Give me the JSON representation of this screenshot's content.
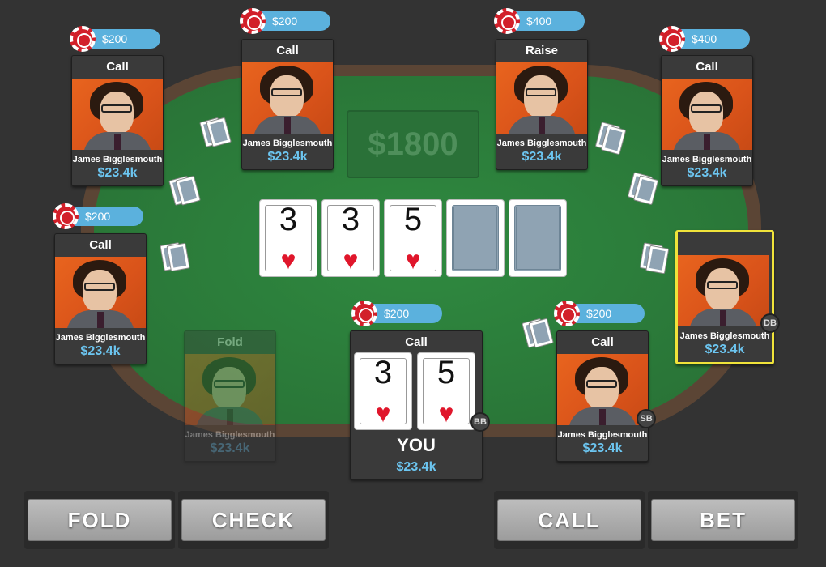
{
  "pot": "$1800",
  "board": [
    {
      "rank": "3",
      "suit": "♥"
    },
    {
      "rank": "3",
      "suit": "♥"
    },
    {
      "rank": "5",
      "suit": "♥"
    },
    {
      "back": true
    },
    {
      "back": true
    }
  ],
  "players": [
    {
      "action": "Call",
      "name": "James Bigglesmouth",
      "stack": "$23.4k",
      "bet": "$200"
    },
    {
      "action": "Call",
      "name": "James Bigglesmouth",
      "stack": "$23.4k",
      "bet": "$200"
    },
    {
      "action": "Raise",
      "name": "James Bigglesmouth",
      "stack": "$23.4k",
      "bet": "$400"
    },
    {
      "action": "Call",
      "name": "James Bigglesmouth",
      "stack": "$23.4k",
      "bet": "$400"
    },
    {
      "action": "Call",
      "name": "James Bigglesmouth",
      "stack": "$23.4k",
      "bet": "$200"
    },
    {
      "action": "",
      "name": "James Bigglesmouth",
      "stack": "$23.4k",
      "badge": "DB"
    },
    {
      "action": "Fold",
      "name": "James Bigglesmouth",
      "stack": "$23.4k"
    },
    {
      "action": "Call",
      "name": "James Bigglesmouth",
      "stack": "$23.4k",
      "bet": "$200",
      "badge": "SB"
    }
  ],
  "you": {
    "action": "Call",
    "label": "YOU",
    "stack": "$23.4k",
    "bet": "$200",
    "badge": "BB",
    "cards": [
      {
        "rank": "3",
        "suit": "♥"
      },
      {
        "rank": "5",
        "suit": "♥"
      }
    ]
  },
  "buttons": {
    "fold": "FOLD",
    "check": "CHECK",
    "call": "CALL",
    "bet": "BET"
  },
  "colors": {
    "felt": "#2e7d3c",
    "rim": "#5b4535",
    "bet_pill": "#5bb1dd",
    "stack_text": "#6cc5f0",
    "active_outline": "#f0e33a",
    "suit_red": "#e0162b"
  }
}
